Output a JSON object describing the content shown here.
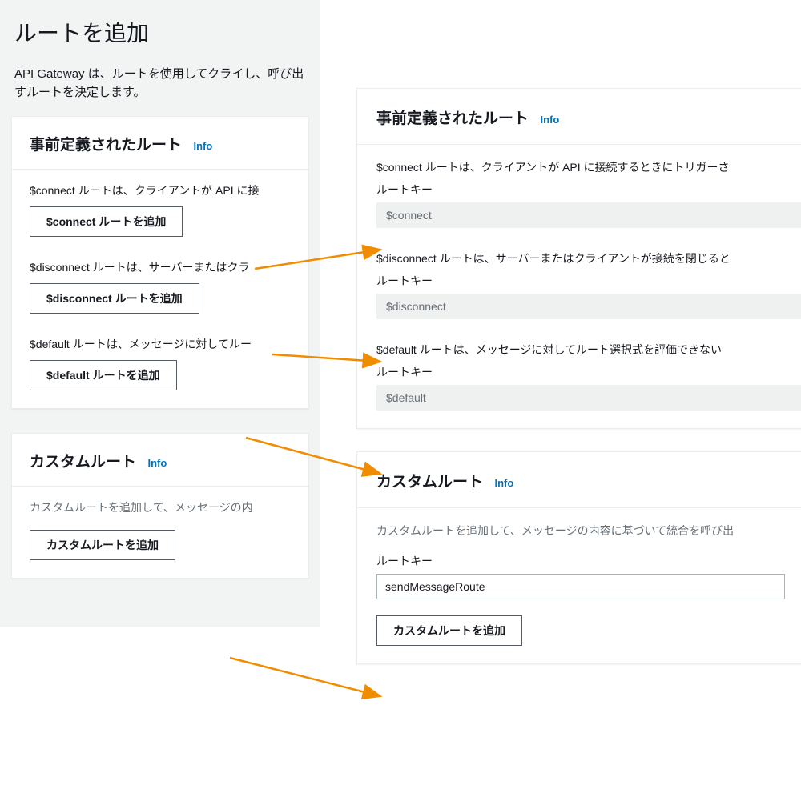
{
  "page": {
    "title": "ルートを追加",
    "description": "API Gateway は、ルートを使用してクライし、呼び出すルートを決定します。"
  },
  "left": {
    "predefined": {
      "title": "事前定義されたルート",
      "info": "Info",
      "routes": [
        {
          "desc": "$connect ルートは、クライアントが API に接",
          "btn": "$connect ルートを追加"
        },
        {
          "desc": "$disconnect ルートは、サーバーまたはクラ",
          "btn": "$disconnect ルートを追加"
        },
        {
          "desc": "$default ルートは、メッセージに対してルー",
          "btn": "$default ルートを追加"
        }
      ]
    },
    "custom": {
      "title": "カスタムルート",
      "info": "Info",
      "desc": "カスタムルートを追加して、メッセージの内",
      "btn": "カスタムルートを追加"
    }
  },
  "right": {
    "predefined": {
      "title": "事前定義されたルート",
      "info": "Info",
      "routes": [
        {
          "desc": "$connect ルートは、クライアントが API に接続するときにトリガーさ",
          "label": "ルートキー",
          "value": "$connect"
        },
        {
          "desc": "$disconnect ルートは、サーバーまたはクライアントが接続を閉じると",
          "label": "ルートキー",
          "value": "$disconnect"
        },
        {
          "desc": "$default ルートは、メッセージに対してルート選択式を評価できない",
          "label": "ルートキー",
          "value": "$default"
        }
      ]
    },
    "custom": {
      "title": "カスタムルート",
      "info": "Info",
      "desc": "カスタムルートを追加して、メッセージの内容に基づいて統合を呼び出",
      "label": "ルートキー",
      "value": "sendMessageRoute",
      "btn": "カスタムルートを追加"
    }
  }
}
